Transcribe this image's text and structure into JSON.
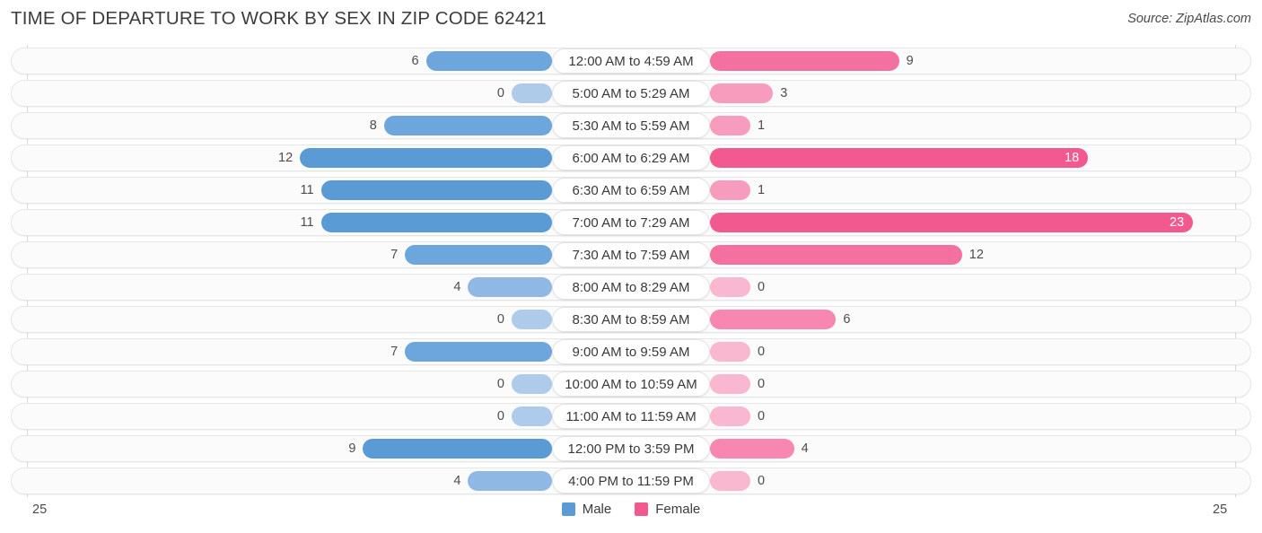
{
  "header": {
    "title": "TIME OF DEPARTURE TO WORK BY SEX IN ZIP CODE 62421",
    "source": "Source: ZipAtlas.com"
  },
  "legend": {
    "male_label": "Male",
    "female_label": "Female",
    "male_color": "#5b9bd5",
    "female_color": "#f2598f"
  },
  "axis": {
    "left_label": "25",
    "right_label": "25"
  },
  "chart_data": {
    "type": "bar",
    "subtype": "diverging-bidirectional-bar",
    "title": "TIME OF DEPARTURE TO WORK BY SEX IN ZIP CODE 62421",
    "subtitle": "",
    "xlabel": "",
    "ylabel": "",
    "xlim": [
      25,
      25
    ],
    "axis_left_max": 25,
    "axis_right_max": 25,
    "grid": true,
    "legend_position": "bottom-center",
    "categories": [
      "12:00 AM to 4:59 AM",
      "5:00 AM to 5:29 AM",
      "5:30 AM to 5:59 AM",
      "6:00 AM to 6:29 AM",
      "6:30 AM to 6:59 AM",
      "7:00 AM to 7:29 AM",
      "7:30 AM to 7:59 AM",
      "8:00 AM to 8:29 AM",
      "8:30 AM to 8:59 AM",
      "9:00 AM to 9:59 AM",
      "10:00 AM to 10:59 AM",
      "11:00 AM to 11:59 AM",
      "12:00 PM to 3:59 PM",
      "4:00 PM to 11:59 PM"
    ],
    "series": [
      {
        "name": "Male",
        "color": "#5b9bd5",
        "direction": "left",
        "values": [
          6,
          0,
          8,
          12,
          11,
          11,
          7,
          4,
          0,
          7,
          0,
          0,
          9,
          4
        ]
      },
      {
        "name": "Female",
        "color": "#f2598f",
        "direction": "right",
        "values": [
          9,
          3,
          1,
          18,
          1,
          23,
          12,
          0,
          6,
          0,
          0,
          0,
          4,
          0
        ]
      }
    ]
  }
}
